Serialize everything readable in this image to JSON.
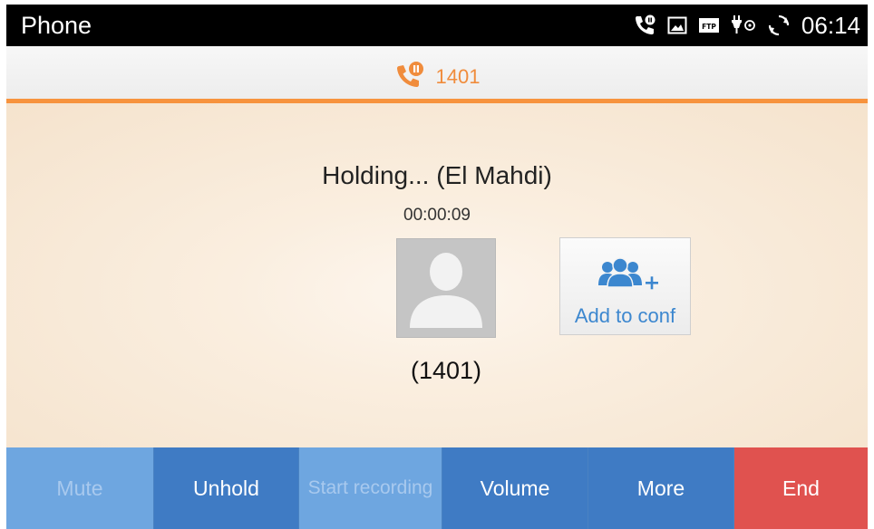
{
  "statusbar": {
    "app_title": "Phone",
    "time": "06:14",
    "icons": [
      "call-hold-icon",
      "image-icon",
      "ftp-icon",
      "usb-debug-icon",
      "sync-icon"
    ]
  },
  "line_header": {
    "line_number": "1401",
    "icon": "call-hold-icon",
    "accent_color": "#f7933e"
  },
  "call": {
    "status": "Holding... (El Mahdi)",
    "duration": "00:00:09",
    "caller_number": "(1401)"
  },
  "conference": {
    "label": "Add to conf",
    "icon": "add-conference-icon"
  },
  "actions": {
    "mute": "Mute",
    "unhold": "Unhold",
    "start_recording": "Start recording",
    "volume": "Volume",
    "more": "More",
    "end": "End"
  },
  "colors": {
    "action_blue": "#3f7bc4",
    "action_disabled": "#6ea6e0",
    "end_red": "#e0524f",
    "link_blue": "#3c87cf"
  }
}
